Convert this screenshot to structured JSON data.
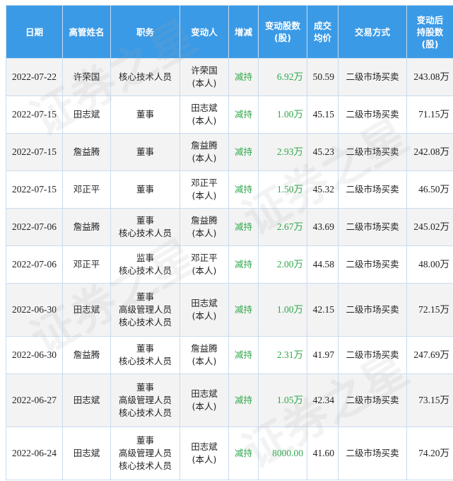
{
  "table": {
    "headers": {
      "date": "日期",
      "name": "高管姓名",
      "position": "职务",
      "changer": "变动人",
      "direction": "增减",
      "shares": "变动股数\n(股)",
      "price": "成交\n均价",
      "method": "交易方式",
      "after": "变动后\n持股数\n(股)"
    },
    "rows": [
      {
        "date": "2022-07-22",
        "name": "许荣国",
        "position": "核心技术人员",
        "changer": "许荣国\n(本人)",
        "direction": "减持",
        "shares": "6.92万",
        "price": "50.59",
        "method": "二级市场买卖",
        "after": "243.08万"
      },
      {
        "date": "2022-07-15",
        "name": "田志斌",
        "position": "董事",
        "changer": "田志斌\n(本人)",
        "direction": "减持",
        "shares": "1.00万",
        "price": "45.15",
        "method": "二级市场买卖",
        "after": "71.15万"
      },
      {
        "date": "2022-07-15",
        "name": "詹益腾",
        "position": "董事",
        "changer": "詹益腾\n(本人)",
        "direction": "减持",
        "shares": "2.93万",
        "price": "45.23",
        "method": "二级市场买卖",
        "after": "242.08万"
      },
      {
        "date": "2022-07-15",
        "name": "邓正平",
        "position": "董事",
        "changer": "邓正平\n(本人)",
        "direction": "减持",
        "shares": "1.50万",
        "price": "45.32",
        "method": "二级市场买卖",
        "after": "46.50万"
      },
      {
        "date": "2022-07-06",
        "name": "詹益腾",
        "position": "董事\n核心技术人员",
        "changer": "詹益腾\n(本人)",
        "direction": "减持",
        "shares": "2.67万",
        "price": "43.69",
        "method": "二级市场买卖",
        "after": "245.02万"
      },
      {
        "date": "2022-07-06",
        "name": "邓正平",
        "position": "监事\n核心技术人员",
        "changer": "邓正平\n(本人)",
        "direction": "减持",
        "shares": "2.00万",
        "price": "44.58",
        "method": "二级市场买卖",
        "after": "48.00万"
      },
      {
        "date": "2022-06-30",
        "name": "田志斌",
        "position": "董事\n高级管理人员\n核心技术人员",
        "changer": "田志斌\n(本人)",
        "direction": "减持",
        "shares": "1.00万",
        "price": "42.15",
        "method": "二级市场买卖",
        "after": "72.15万"
      },
      {
        "date": "2022-06-30",
        "name": "詹益腾",
        "position": "董事\n核心技术人员",
        "changer": "詹益腾\n(本人)",
        "direction": "减持",
        "shares": "2.31万",
        "price": "41.97",
        "method": "二级市场买卖",
        "after": "247.69万"
      },
      {
        "date": "2022-06-27",
        "name": "田志斌",
        "position": "董事\n高级管理人员\n核心技术人员",
        "changer": "田志斌\n(本人)",
        "direction": "减持",
        "shares": "1.05万",
        "price": "42.34",
        "method": "二级市场买卖",
        "after": "73.15万"
      },
      {
        "date": "2022-06-24",
        "name": "田志斌",
        "position": "董事\n高级管理人员\n核心技术人员",
        "changer": "田志斌\n(本人)",
        "direction": "减持",
        "shares": "8000.00",
        "price": "41.60",
        "method": "二级市场买卖",
        "after": "74.20万"
      }
    ]
  },
  "watermark": {
    "text": "证券之星"
  },
  "colors": {
    "header_bg": "#3b9ae6",
    "decrease_green": "#2ea84a",
    "row_alt": "#f3f3f3",
    "border": "#c9dcef"
  }
}
